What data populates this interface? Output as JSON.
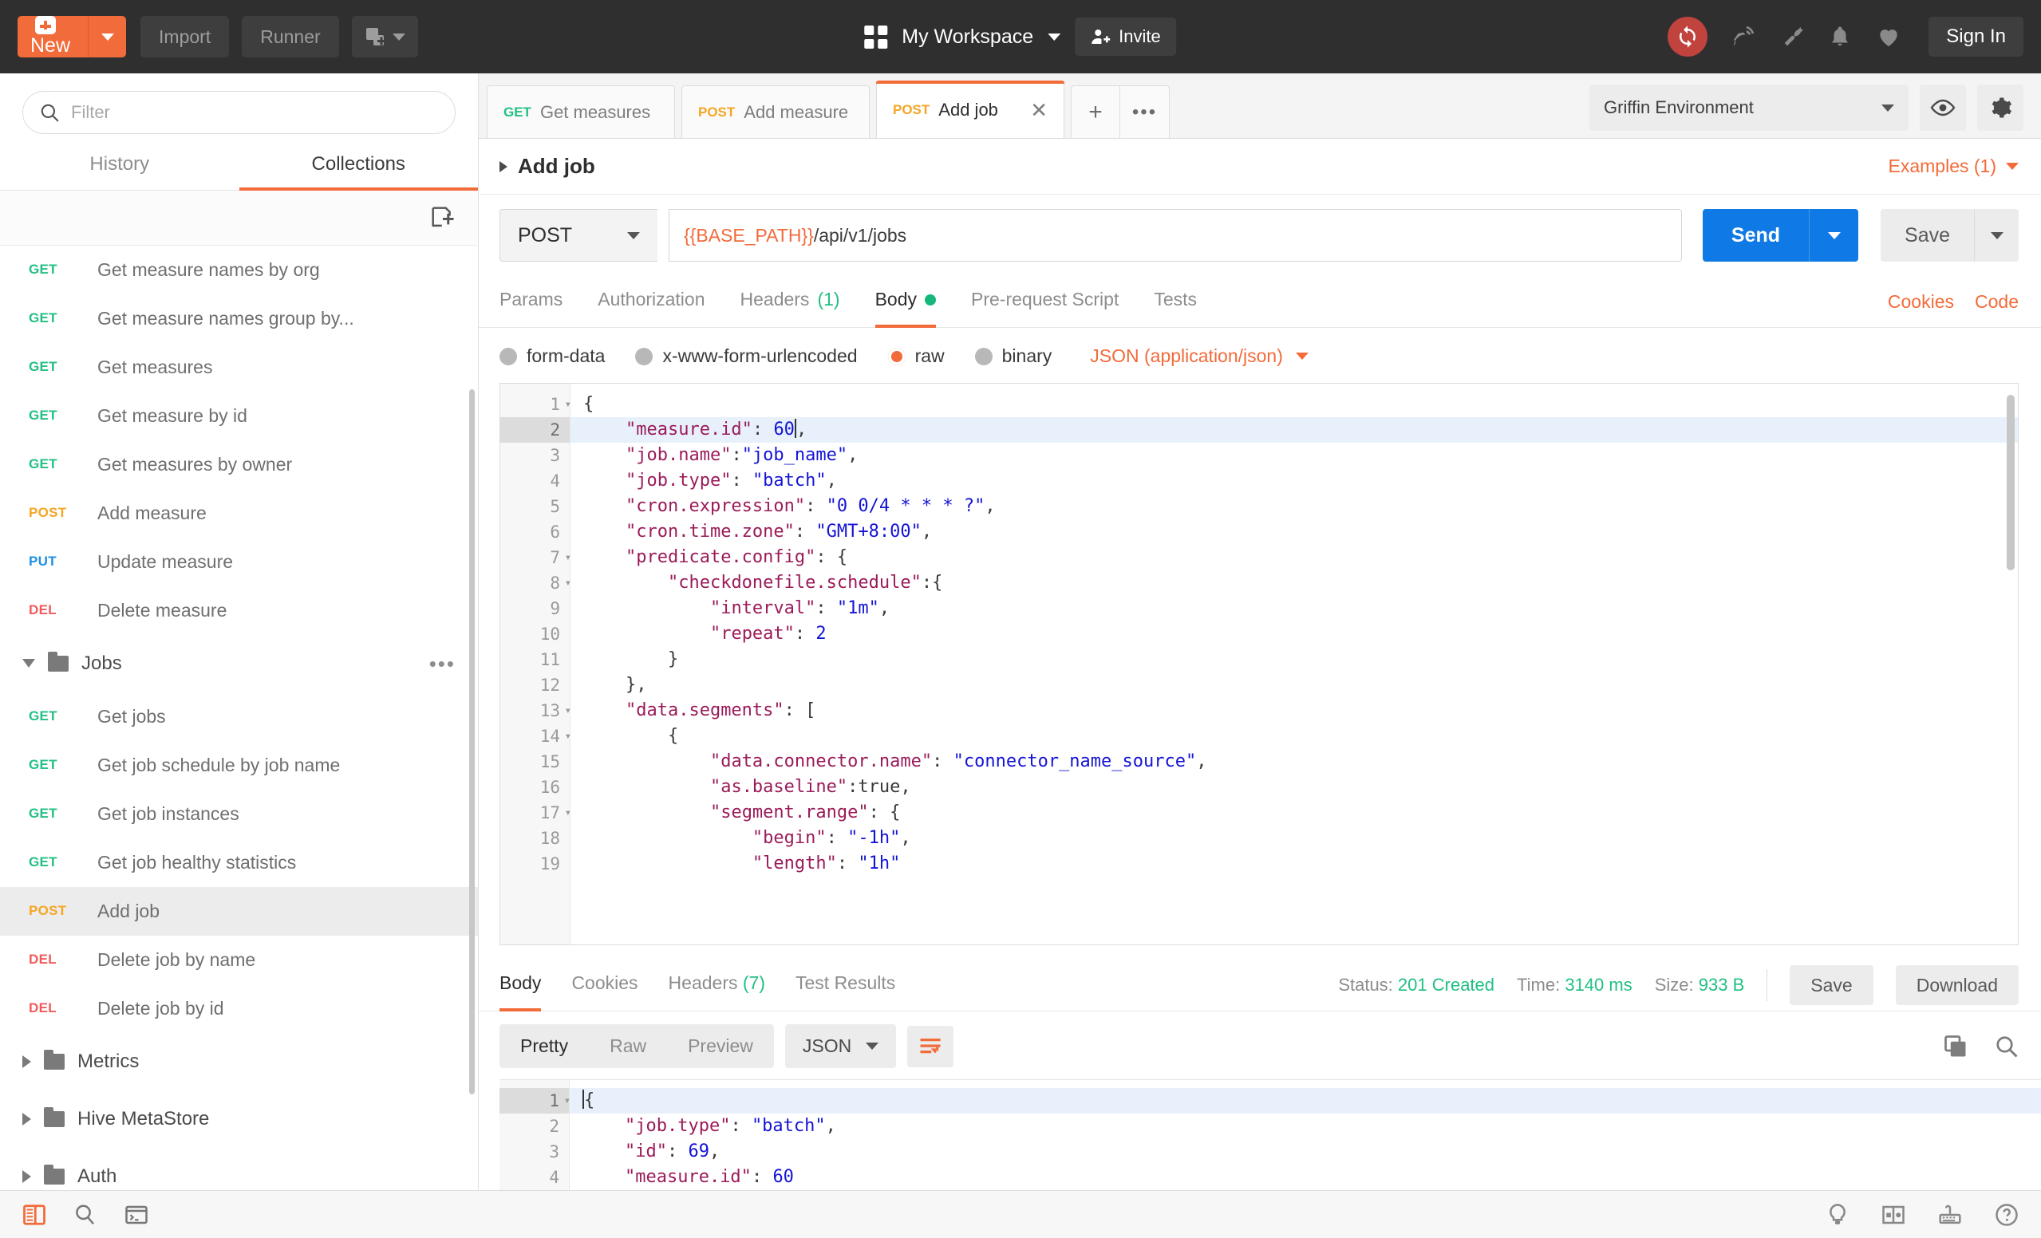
{
  "topbar": {
    "new_label": "New",
    "import_label": "Import",
    "runner_label": "Runner",
    "workspace_name": "My Workspace",
    "invite_label": "Invite",
    "signin_label": "Sign In",
    "icons": [
      "sync-icon",
      "satellite-icon",
      "wrench-icon",
      "bell-icon",
      "heart-icon"
    ],
    "accent": "#f26b3a"
  },
  "sidebar": {
    "filter_placeholder": "Filter",
    "filter_value": "",
    "tabs": [
      {
        "label": "History",
        "active": false
      },
      {
        "label": "Collections",
        "active": true
      }
    ],
    "items": [
      {
        "method": "GET",
        "label": "Get measure names by org",
        "type": "request",
        "active": false
      },
      {
        "method": "GET",
        "label": "Get measure names group by...",
        "type": "request",
        "active": false
      },
      {
        "method": "GET",
        "label": "Get measures",
        "type": "request",
        "active": false
      },
      {
        "method": "GET",
        "label": "Get measure by id",
        "type": "request",
        "active": false
      },
      {
        "method": "GET",
        "label": "Get measures by owner",
        "type": "request",
        "active": false
      },
      {
        "method": "POST",
        "label": "Add measure",
        "type": "request",
        "active": false
      },
      {
        "method": "PUT",
        "label": "Update measure",
        "type": "request",
        "active": false
      },
      {
        "method": "DEL",
        "label": "Delete measure",
        "type": "request",
        "active": false
      },
      {
        "method": "",
        "label": "Jobs",
        "type": "folder",
        "expanded": true,
        "active": false
      },
      {
        "method": "GET",
        "label": "Get jobs",
        "type": "request",
        "active": false
      },
      {
        "method": "GET",
        "label": "Get job schedule by job name",
        "type": "request",
        "active": false
      },
      {
        "method": "GET",
        "label": "Get job instances",
        "type": "request",
        "active": false
      },
      {
        "method": "GET",
        "label": "Get job healthy statistics",
        "type": "request",
        "active": false
      },
      {
        "method": "POST",
        "label": "Add job",
        "type": "request",
        "active": true
      },
      {
        "method": "DEL",
        "label": "Delete job by name",
        "type": "request",
        "active": false
      },
      {
        "method": "DEL",
        "label": "Delete job by id",
        "type": "request",
        "active": false
      },
      {
        "method": "",
        "label": "Metrics",
        "type": "folder",
        "expanded": false,
        "active": false
      },
      {
        "method": "",
        "label": "Hive MetaStore",
        "type": "folder",
        "expanded": false,
        "active": false
      },
      {
        "method": "",
        "label": "Auth",
        "type": "folder",
        "expanded": false,
        "active": false
      }
    ]
  },
  "request_tabs": [
    {
      "method": "GET",
      "label": "Get measures",
      "active": false
    },
    {
      "method": "POST",
      "label": "Add measure",
      "active": false
    },
    {
      "method": "POST",
      "label": "Add job",
      "active": true
    }
  ],
  "tab_controls": {
    "add": "+",
    "more": "•••"
  },
  "environment": {
    "selected": "Griffin Environment",
    "eye_icon": "eye-icon",
    "gear_icon": "gear-icon"
  },
  "request": {
    "title": "Add job",
    "examples_label": "Examples (1)",
    "method": "POST",
    "url_variable": "{{BASE_PATH}}",
    "url_path": "/api/v1/jobs",
    "send_label": "Send",
    "save_label": "Save",
    "tabs": [
      {
        "label": "Params",
        "count": "",
        "active": false,
        "dot": false
      },
      {
        "label": "Authorization",
        "count": "",
        "active": false,
        "dot": false
      },
      {
        "label": "Headers",
        "count": "(1)",
        "active": false,
        "dot": false
      },
      {
        "label": "Body",
        "count": "",
        "active": true,
        "dot": true
      },
      {
        "label": "Pre-request Script",
        "count": "",
        "active": false,
        "dot": false
      },
      {
        "label": "Tests",
        "count": "",
        "active": false,
        "dot": false
      }
    ],
    "links": [
      "Cookies",
      "Code"
    ],
    "body_modes": [
      {
        "label": "form-data",
        "selected": false
      },
      {
        "label": "x-www-form-urlencoded",
        "selected": false
      },
      {
        "label": "raw",
        "selected": true
      },
      {
        "label": "binary",
        "selected": false
      }
    ],
    "content_type": "JSON (application/json)"
  },
  "request_body": {
    "highlight_line": 2,
    "cursor_line": 2,
    "lines": [
      {
        "n": 1,
        "fold": true,
        "tokens": [
          {
            "t": "p",
            "v": "{"
          }
        ]
      },
      {
        "n": 2,
        "fold": false,
        "tokens": [
          {
            "t": "p",
            "v": "    "
          },
          {
            "t": "k",
            "v": "\"measure.id\""
          },
          {
            "t": "p",
            "v": ": "
          },
          {
            "t": "n",
            "v": "60"
          },
          {
            "t": "cursor",
            "v": ""
          },
          {
            "t": "p",
            "v": ","
          }
        ]
      },
      {
        "n": 3,
        "fold": false,
        "tokens": [
          {
            "t": "p",
            "v": "    "
          },
          {
            "t": "k",
            "v": "\"job.name\""
          },
          {
            "t": "p",
            "v": ":"
          },
          {
            "t": "s",
            "v": "\"job_name\""
          },
          {
            "t": "p",
            "v": ","
          }
        ]
      },
      {
        "n": 4,
        "fold": false,
        "tokens": [
          {
            "t": "p",
            "v": "    "
          },
          {
            "t": "k",
            "v": "\"job.type\""
          },
          {
            "t": "p",
            "v": ": "
          },
          {
            "t": "s",
            "v": "\"batch\""
          },
          {
            "t": "p",
            "v": ","
          }
        ]
      },
      {
        "n": 5,
        "fold": false,
        "tokens": [
          {
            "t": "p",
            "v": "    "
          },
          {
            "t": "k",
            "v": "\"cron.expression\""
          },
          {
            "t": "p",
            "v": ": "
          },
          {
            "t": "s",
            "v": "\"0 0/4 * * * ?\""
          },
          {
            "t": "p",
            "v": ","
          }
        ]
      },
      {
        "n": 6,
        "fold": false,
        "tokens": [
          {
            "t": "p",
            "v": "    "
          },
          {
            "t": "k",
            "v": "\"cron.time.zone\""
          },
          {
            "t": "p",
            "v": ": "
          },
          {
            "t": "s",
            "v": "\"GMT+8:00\""
          },
          {
            "t": "p",
            "v": ","
          }
        ]
      },
      {
        "n": 7,
        "fold": true,
        "tokens": [
          {
            "t": "p",
            "v": "    "
          },
          {
            "t": "k",
            "v": "\"predicate.config\""
          },
          {
            "t": "p",
            "v": ": {"
          }
        ]
      },
      {
        "n": 8,
        "fold": true,
        "tokens": [
          {
            "t": "p",
            "v": "        "
          },
          {
            "t": "k",
            "v": "\"checkdonefile.schedule\""
          },
          {
            "t": "p",
            "v": ":{"
          }
        ]
      },
      {
        "n": 9,
        "fold": false,
        "tokens": [
          {
            "t": "p",
            "v": "            "
          },
          {
            "t": "k",
            "v": "\"interval\""
          },
          {
            "t": "p",
            "v": ": "
          },
          {
            "t": "s",
            "v": "\"1m\""
          },
          {
            "t": "p",
            "v": ","
          }
        ]
      },
      {
        "n": 10,
        "fold": false,
        "tokens": [
          {
            "t": "p",
            "v": "            "
          },
          {
            "t": "k",
            "v": "\"repeat\""
          },
          {
            "t": "p",
            "v": ": "
          },
          {
            "t": "n",
            "v": "2"
          }
        ]
      },
      {
        "n": 11,
        "fold": false,
        "tokens": [
          {
            "t": "p",
            "v": "        }"
          }
        ]
      },
      {
        "n": 12,
        "fold": false,
        "tokens": [
          {
            "t": "p",
            "v": "    },"
          }
        ]
      },
      {
        "n": 13,
        "fold": true,
        "tokens": [
          {
            "t": "p",
            "v": "    "
          },
          {
            "t": "k",
            "v": "\"data.segments\""
          },
          {
            "t": "p",
            "v": ": ["
          }
        ]
      },
      {
        "n": 14,
        "fold": true,
        "tokens": [
          {
            "t": "p",
            "v": "        {"
          }
        ]
      },
      {
        "n": 15,
        "fold": false,
        "tokens": [
          {
            "t": "p",
            "v": "            "
          },
          {
            "t": "k",
            "v": "\"data.connector.name\""
          },
          {
            "t": "p",
            "v": ": "
          },
          {
            "t": "s",
            "v": "\"connector_name_source\""
          },
          {
            "t": "p",
            "v": ","
          }
        ]
      },
      {
        "n": 16,
        "fold": false,
        "tokens": [
          {
            "t": "p",
            "v": "            "
          },
          {
            "t": "k",
            "v": "\"as.baseline\""
          },
          {
            "t": "p",
            "v": ":true,"
          }
        ]
      },
      {
        "n": 17,
        "fold": true,
        "tokens": [
          {
            "t": "p",
            "v": "            "
          },
          {
            "t": "k",
            "v": "\"segment.range\""
          },
          {
            "t": "p",
            "v": ": {"
          }
        ]
      },
      {
        "n": 18,
        "fold": false,
        "tokens": [
          {
            "t": "p",
            "v": "                "
          },
          {
            "t": "k",
            "v": "\"begin\""
          },
          {
            "t": "p",
            "v": ": "
          },
          {
            "t": "s",
            "v": "\"-1h\""
          },
          {
            "t": "p",
            "v": ","
          }
        ]
      },
      {
        "n": 19,
        "fold": false,
        "tokens": [
          {
            "t": "p",
            "v": "                "
          },
          {
            "t": "k",
            "v": "\"length\""
          },
          {
            "t": "p",
            "v": ": "
          },
          {
            "t": "s",
            "v": "\"1h\""
          }
        ]
      }
    ]
  },
  "response": {
    "tabs": [
      {
        "label": "Body",
        "count": "",
        "active": true
      },
      {
        "label": "Cookies",
        "count": "",
        "active": false
      },
      {
        "label": "Headers",
        "count": "(7)",
        "active": false
      },
      {
        "label": "Test Results",
        "count": "",
        "active": false
      }
    ],
    "status_label": "Status:",
    "status_value": "201 Created",
    "time_label": "Time:",
    "time_value": "3140 ms",
    "size_label": "Size:",
    "size_value": "933 B",
    "save_label": "Save",
    "download_label": "Download",
    "view_modes": [
      {
        "label": "Pretty",
        "active": true
      },
      {
        "label": "Raw",
        "active": false
      },
      {
        "label": "Preview",
        "active": false
      }
    ],
    "format": "JSON",
    "wrap_icon": "word-wrap-icon",
    "copy_icon": "copy-icon",
    "search_icon": "search-icon"
  },
  "response_body": {
    "highlight_line": 1,
    "lines": [
      {
        "n": 1,
        "fold": true,
        "tokens": [
          {
            "t": "cursor",
            "v": ""
          },
          {
            "t": "p",
            "v": "{"
          }
        ]
      },
      {
        "n": 2,
        "fold": false,
        "tokens": [
          {
            "t": "p",
            "v": "    "
          },
          {
            "t": "k",
            "v": "\"job.type\""
          },
          {
            "t": "p",
            "v": ": "
          },
          {
            "t": "s",
            "v": "\"batch\""
          },
          {
            "t": "p",
            "v": ","
          }
        ]
      },
      {
        "n": 3,
        "fold": false,
        "tokens": [
          {
            "t": "p",
            "v": "    "
          },
          {
            "t": "k",
            "v": "\"id\""
          },
          {
            "t": "p",
            "v": ": "
          },
          {
            "t": "n",
            "v": "69"
          },
          {
            "t": "p",
            "v": ","
          }
        ]
      },
      {
        "n": 4,
        "fold": false,
        "tokens": [
          {
            "t": "p",
            "v": "    "
          },
          {
            "t": "k",
            "v": "\"measure.id\""
          },
          {
            "t": "p",
            "v": ": "
          },
          {
            "t": "n",
            "v": "60"
          }
        ]
      }
    ]
  },
  "statusbar": {
    "left_icons": [
      "sidebar-toggle-icon",
      "find-icon",
      "console-icon"
    ],
    "right_icons": [
      "bulb-icon",
      "layout-icon",
      "keyboard-icon",
      "help-icon"
    ]
  }
}
